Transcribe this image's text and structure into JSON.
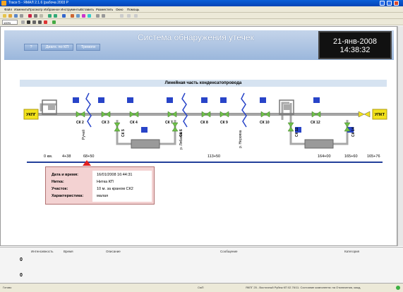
{
  "window": {
    "title": "Trace 5 - ЯМАЛ 2.1.6 (рабоча 2003 Р",
    "buttons": [
      "minimize",
      "maximize",
      "close"
    ]
  },
  "menu": [
    "Файл",
    "Изменить",
    "Просмотр",
    "Избранное",
    "Инструменты",
    "Вставить",
    "Разместить",
    "Окно",
    "Помощь"
  ],
  "zoom": "100%",
  "header": {
    "title": "Система обнаружения утечек",
    "buttons": [
      "?",
      "Диагн. по КП",
      "Тревоги"
    ],
    "clock_date": "21-янв-2008",
    "clock_time": "14:38:32"
  },
  "diagram": {
    "title": "Линейная часть конденсатопровода",
    "endpoint_left": "УКПГ",
    "endpoint_right": "УПКТ",
    "valves_top": [
      "СК 2",
      "СК 3",
      "СК 4",
      "СК 7",
      "СК 8",
      "СК 9",
      "СК 10",
      "СК 12"
    ],
    "valves_vertical": [
      "СК 5",
      "СК 6",
      "СК 11",
      "СК 14"
    ],
    "rivers": [
      "Ручей",
      "р. Лябаяха",
      "р. Нерояха"
    ],
    "scale_labels": [
      "0 км.",
      "4+38",
      "68+50",
      "113+50",
      "164+00",
      "165+60",
      "165+76"
    ]
  },
  "info": {
    "rows": [
      {
        "label": "Дата и время:",
        "value": "16/01/2008 16:44:31"
      },
      {
        "label": "Нитка:",
        "value": "Нитка КП"
      },
      {
        "label": "Участок:",
        "value": "10 м. за краном СК2"
      },
      {
        "label": "Характеристика:",
        "value": "малая"
      }
    ]
  },
  "events": {
    "columns": [
      "Интенсивность",
      "Время",
      "Описание",
      "Сообщение",
      "Категория"
    ],
    "counts": [
      "0",
      "0"
    ]
  },
  "statusbar": {
    "left": "Готово",
    "center": "СмП",
    "right": "ЯКПГ 25 - Восточный Рубеж КП 02.76/11. Состояние компонента: на Отключения, кажд."
  },
  "colors": {
    "banner": "#9bb7dc",
    "pipe": "#a8a8a8",
    "valve": "#6fc04a",
    "marker": "#e02020",
    "endpoint": "#f2e21c",
    "info_bg": "#f3d2d2"
  }
}
